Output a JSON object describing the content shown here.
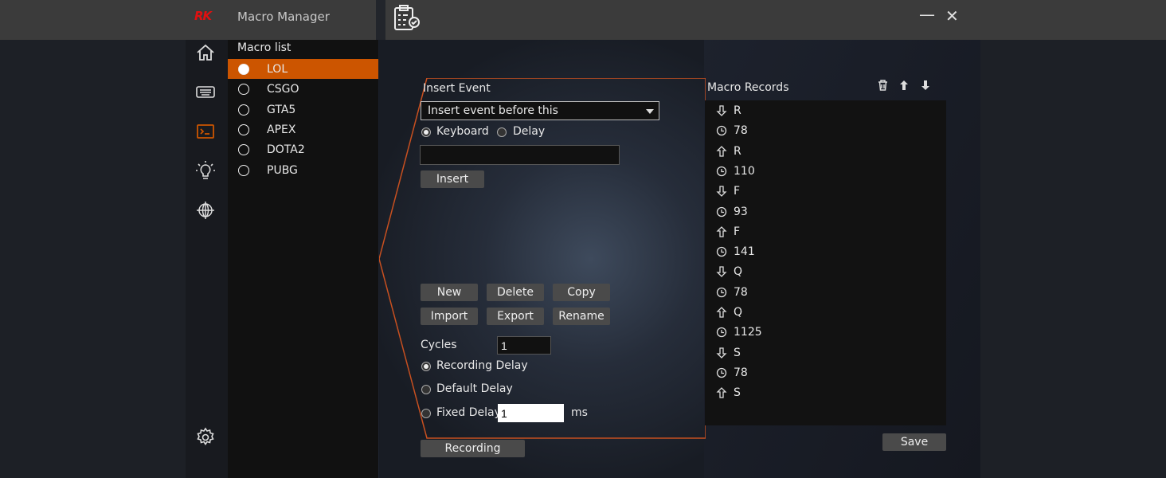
{
  "titlebar": {
    "logo": "RK",
    "title": "Macro Manager",
    "minimize": "—",
    "close": "✕"
  },
  "nav": [
    "home-icon",
    "keyboard-icon",
    "macro-icon",
    "light-icon",
    "network-icon",
    "settings-icon"
  ],
  "macro_list": {
    "title": "Macro list",
    "items": [
      {
        "label": "LOL",
        "selected": true
      },
      {
        "label": "CSGO"
      },
      {
        "label": "GTA5"
      },
      {
        "label": "APEX"
      },
      {
        "label": "DOTA2"
      },
      {
        "label": "PUBG"
      }
    ]
  },
  "insert": {
    "title": "Insert Event",
    "select_value": "Insert event before this",
    "keyboard": "Keyboard",
    "delay": "Delay",
    "input_value": "",
    "insert_button": "Insert"
  },
  "buttons": {
    "new": "New",
    "delete": "Delete",
    "copy": "Copy",
    "import": "Import",
    "export": "Export",
    "rename": "Rename"
  },
  "cycles": {
    "label": "Cycles",
    "value": "1"
  },
  "delay_mode": {
    "recording": "Recording Delay",
    "default": "Default Delay",
    "fixed": "Fixed Delay",
    "fixed_value": "1",
    "unit": "ms"
  },
  "recording_button": "Recording",
  "records": {
    "title": "Macro Records",
    "save": "Save",
    "items": [
      {
        "type": "down",
        "value": "R"
      },
      {
        "type": "delay",
        "value": "78"
      },
      {
        "type": "up",
        "value": "R"
      },
      {
        "type": "delay",
        "value": "110"
      },
      {
        "type": "down",
        "value": "F"
      },
      {
        "type": "delay",
        "value": "93"
      },
      {
        "type": "up",
        "value": "F"
      },
      {
        "type": "delay",
        "value": "141"
      },
      {
        "type": "down",
        "value": "Q"
      },
      {
        "type": "delay",
        "value": "78"
      },
      {
        "type": "up",
        "value": "Q"
      },
      {
        "type": "delay",
        "value": "1125"
      },
      {
        "type": "down",
        "value": "S"
      },
      {
        "type": "delay",
        "value": "78"
      },
      {
        "type": "up",
        "value": "S"
      }
    ]
  },
  "colors": {
    "accent": "#cc5500",
    "logo": "#e01010"
  }
}
